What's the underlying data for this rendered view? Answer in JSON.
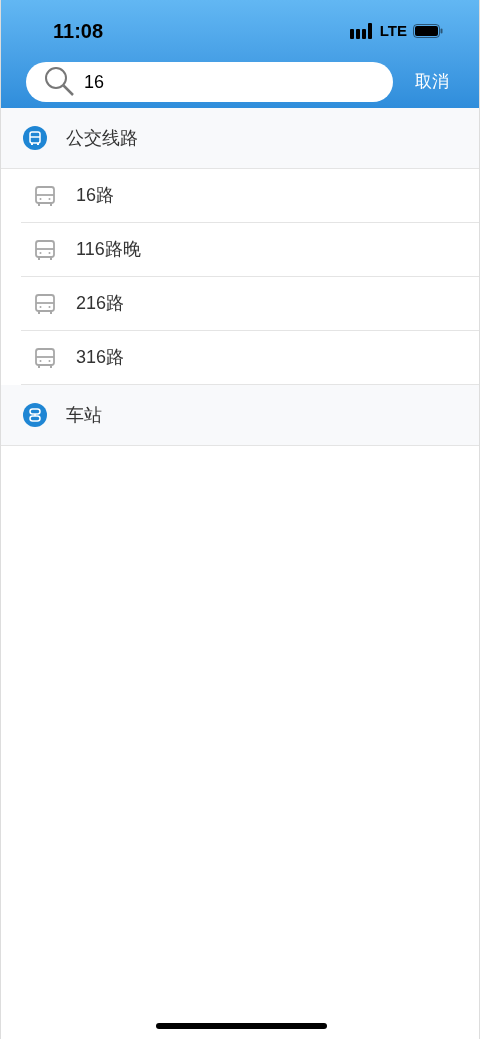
{
  "status_bar": {
    "time": "11:08",
    "network": "LTE"
  },
  "search": {
    "value": "16",
    "cancel": "取消"
  },
  "sections": [
    {
      "kind": "route",
      "title": "公交线路",
      "items": [
        "16路",
        "116路晚",
        "216路",
        "316路"
      ]
    },
    {
      "kind": "station",
      "title": "车站"
    }
  ]
}
